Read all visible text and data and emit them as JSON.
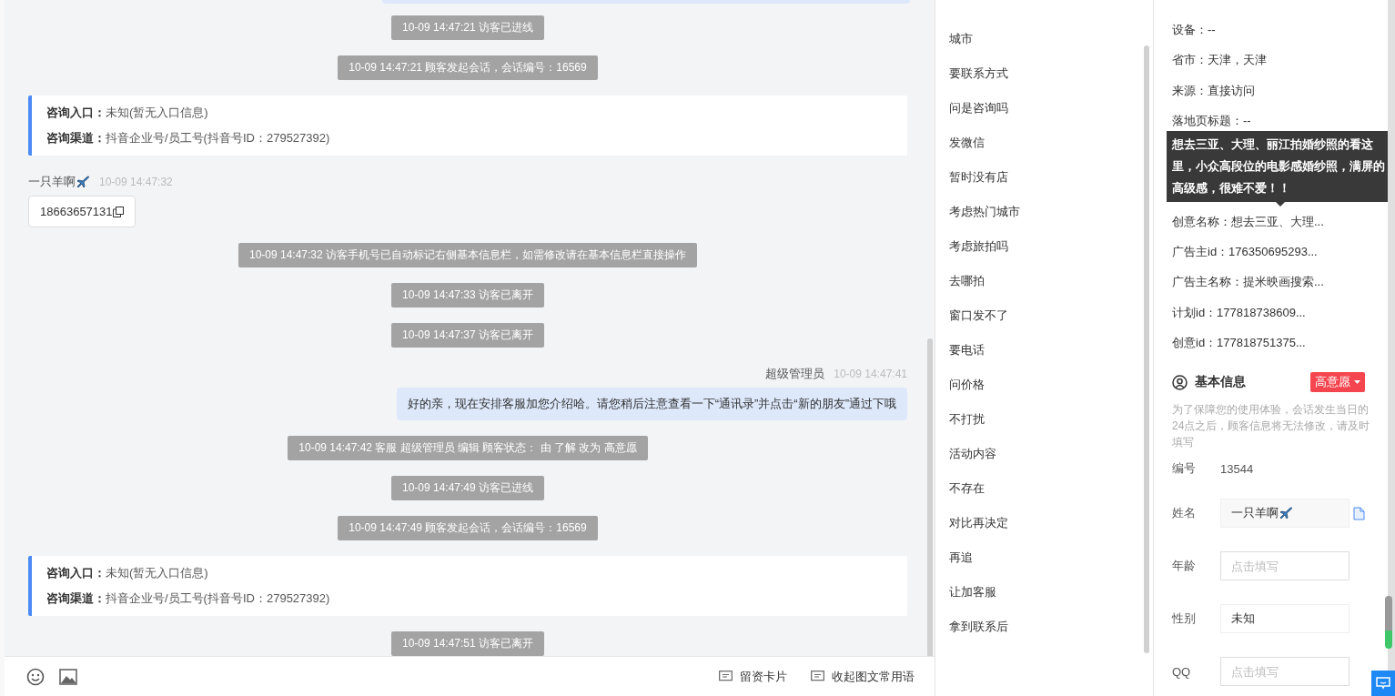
{
  "chat": {
    "messages": [
      {
        "kind": "system",
        "text": "10-09 14:47:21 访客已进线"
      },
      {
        "kind": "system",
        "text": "10-09 14:47:21 顾客发起会话，会话编号：16569"
      },
      {
        "kind": "info",
        "rows": [
          {
            "label": "咨询入口：",
            "value": "未知(暂无入口信息)"
          },
          {
            "label": "咨询渠道：",
            "value": "抖音企业号/员工号(抖音号ID：279527392)"
          }
        ]
      },
      {
        "kind": "visitor",
        "name": "一只羊啊",
        "time": "10-09 14:47:32",
        "text": "18663657131"
      },
      {
        "kind": "system",
        "text": "10-09 14:47:32 访客手机号已自动标记右侧基本信息栏，如需修改请在基本信息栏直接操作"
      },
      {
        "kind": "system",
        "text": "10-09 14:47:33 访客已离开"
      },
      {
        "kind": "system",
        "text": "10-09 14:47:37 访客已离开"
      },
      {
        "kind": "agent",
        "name": "超级管理员",
        "time": "10-09 14:47:41",
        "text": "好的亲，现在安排客服加您介绍哈。请您稍后注意查看一下“通讯录”并点击“新的朋友”通过下哦"
      },
      {
        "kind": "system",
        "text": "10-09 14:47:42 客服 超级管理员 编辑 顾客状态： 由 了解 改为 高意愿"
      },
      {
        "kind": "system",
        "text": "10-09 14:47:49 访客已进线"
      },
      {
        "kind": "system",
        "text": "10-09 14:47:49 顾客发起会话，会话编号：16569"
      },
      {
        "kind": "info",
        "rows": [
          {
            "label": "咨询入口：",
            "value": "未知(暂无入口信息)"
          },
          {
            "label": "咨询渠道：",
            "value": "抖音企业号/员工号(抖音号ID：279527392)"
          }
        ]
      },
      {
        "kind": "system",
        "text": "10-09 14:47:51 访客已离开"
      }
    ],
    "toolbar": {
      "actions": [
        "留资卡片",
        "收起图文常用语"
      ]
    }
  },
  "phrases": [
    "城市",
    "要联系方式",
    "问是咨询吗",
    "发微信",
    "暂时没有店",
    "考虑热门城市",
    "考虑旅拍吗",
    "去哪拍",
    "窗口发不了",
    "要电话",
    "问价格",
    "不打扰",
    "活动内容",
    "不存在",
    "对比再决定",
    "再追",
    "让加客服",
    "拿到联系后"
  ],
  "source_info": {
    "rows": [
      {
        "kind": "row",
        "text": "设备：--"
      },
      {
        "kind": "row",
        "text": "省市：天津，天津"
      },
      {
        "kind": "row",
        "text": "来源：直接访问"
      },
      {
        "kind": "row",
        "text": "落地页标题：--"
      },
      {
        "kind": "tooltip",
        "text": "想去三亚、大理、丽江拍婚纱照的看这里，小众高段位的电影感婚纱照，满屏的高级感，很难不爱！！"
      },
      {
        "kind": "row",
        "text": "创意名称：想去三亚、大理..."
      },
      {
        "kind": "row",
        "text": "广告主id：176350695293..."
      },
      {
        "kind": "row",
        "text": "广告主名称：提米映画搜索..."
      },
      {
        "kind": "row",
        "text": "计划id：177818738609..."
      },
      {
        "kind": "row",
        "text": "创意id：177818751375..."
      }
    ]
  },
  "basic_info": {
    "title": "基本信息",
    "status": "高意愿",
    "note": "为了保障您的使用体验，会话发生当日的24点之后，顾客信息将无法修改，请及时填写",
    "fields": [
      {
        "kind": "static",
        "label": "编号",
        "value": "13544"
      },
      {
        "kind": "readonly",
        "label": "姓名",
        "value": "一只羊啊"
      },
      {
        "kind": "input",
        "label": "年龄",
        "placeholder": "点击填写"
      },
      {
        "kind": "select",
        "label": "性别",
        "value": "未知"
      },
      {
        "kind": "input",
        "label": "QQ",
        "placeholder": "点击填写"
      }
    ]
  }
}
